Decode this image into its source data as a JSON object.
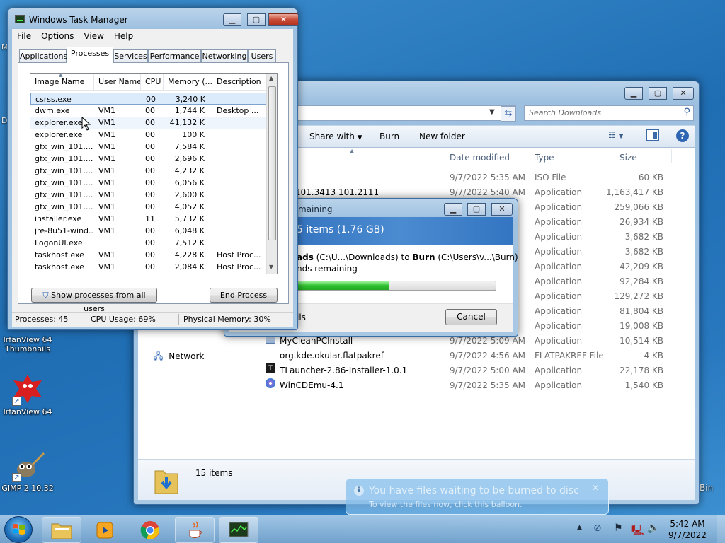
{
  "desktop": {
    "icons": [
      {
        "label": "IrfanView 64 Thumbnails"
      },
      {
        "label": "IrfanView 64"
      },
      {
        "label": "GIMP 2.10.32"
      }
    ],
    "edge_label_left": "M",
    "edge_label_left2": "D",
    "edge_label_right": "Bin"
  },
  "explorer": {
    "search_placeholder": "Search Downloads",
    "toolbar": {
      "share_with": "Share with",
      "burn": "Burn",
      "new_folder": "New folder"
    },
    "columns": {
      "date": "Date modified",
      "type": "Type",
      "size": "Size"
    },
    "nav": {
      "network": "Network"
    },
    "files": [
      {
        "name": "",
        "date": "9/7/2022 5:35 AM",
        "type": "ISO File",
        "size": "60 KB"
      },
      {
        "name": "vin 101.3413 101.2111",
        "date": "9/7/2022 5:40 AM",
        "type": "Application",
        "size": "1,163,417 KB"
      },
      {
        "name": "",
        "date": "",
        "type": "Application",
        "size": "259,066 KB"
      },
      {
        "name": "",
        "date": "",
        "type": "Application",
        "size": "26,934 KB"
      },
      {
        "name": "",
        "date": "",
        "type": "Application",
        "size": "3,682 KB"
      },
      {
        "name": "",
        "date": "",
        "type": "Application",
        "size": "3,682 KB"
      },
      {
        "name": "",
        "date": "",
        "type": "Application",
        "size": "42,209 KB"
      },
      {
        "name": "",
        "date": "",
        "type": "Application",
        "size": "92,284 KB"
      },
      {
        "name": "",
        "date": "",
        "type": "Application",
        "size": "129,272 KB"
      },
      {
        "name": "",
        "date": "",
        "type": "Application",
        "size": "81,804 KB"
      },
      {
        "name": "",
        "date": "",
        "type": "Application",
        "size": "19,008 KB"
      },
      {
        "name": "MyCleanPCInstall",
        "date": "9/7/2022 5:09 AM",
        "type": "Application",
        "size": "10,514 KB"
      },
      {
        "name": "org.kde.okular.flatpakref",
        "date": "9/7/2022 4:56 AM",
        "type": "FLATPAKREF File",
        "size": "4 KB"
      },
      {
        "name": "TLauncher-2.86-Installer-1.0.1",
        "date": "9/7/2022 5:00 AM",
        "type": "Application",
        "size": "22,178 KB"
      },
      {
        "name": "WinCDEmu-4.1",
        "date": "9/7/2022 5:35 AM",
        "type": "Application",
        "size": "1,540 KB"
      }
    ],
    "status_count": "15 items"
  },
  "copy_dialog": {
    "title": "maining",
    "heading": "5 items (1.76 GB)",
    "from_bold": "ads",
    "from_path": "(C:\\U...\\Downloads) to",
    "to_bold": "Burn",
    "to_path": "(C:\\Users\\v...\\Burn)",
    "remaining": "nds remaining",
    "progress": 0.46,
    "details": "ils",
    "cancel": "Cancel"
  },
  "task_manager": {
    "title": "Windows Task Manager",
    "menu": [
      "File",
      "Options",
      "View",
      "Help"
    ],
    "tabs": [
      "Applications",
      "Processes",
      "Services",
      "Performance",
      "Networking",
      "Users"
    ],
    "active_tab": 1,
    "columns": [
      "Image Name",
      "User Name",
      "CPU",
      "Memory (...",
      "Description"
    ],
    "processes": [
      {
        "image": "csrss.exe",
        "user": "",
        "cpu": "00",
        "mem": "3,240 K",
        "desc": ""
      },
      {
        "image": "dwm.exe",
        "user": "VM1",
        "cpu": "00",
        "mem": "1,744 K",
        "desc": "Desktop ..."
      },
      {
        "image": "explorer.exe",
        "user": "VM1",
        "cpu": "00",
        "mem": "41,132 K",
        "desc": ""
      },
      {
        "image": "explorer.exe",
        "user": "VM1",
        "cpu": "00",
        "mem": "100 K",
        "desc": ""
      },
      {
        "image": "gfx_win_101....",
        "user": "VM1",
        "cpu": "00",
        "mem": "7,584 K",
        "desc": ""
      },
      {
        "image": "gfx_win_101....",
        "user": "VM1",
        "cpu": "00",
        "mem": "2,696 K",
        "desc": ""
      },
      {
        "image": "gfx_win_101....",
        "user": "VM1",
        "cpu": "00",
        "mem": "4,232 K",
        "desc": ""
      },
      {
        "image": "gfx_win_101....",
        "user": "VM1",
        "cpu": "00",
        "mem": "6,056 K",
        "desc": ""
      },
      {
        "image": "gfx_win_101....",
        "user": "VM1",
        "cpu": "00",
        "mem": "2,600 K",
        "desc": ""
      },
      {
        "image": "gfx_win_101....",
        "user": "VM1",
        "cpu": "00",
        "mem": "4,052 K",
        "desc": ""
      },
      {
        "image": "installer.exe",
        "user": "VM1",
        "cpu": "11",
        "mem": "5,732 K",
        "desc": ""
      },
      {
        "image": "jre-8u51-wind...",
        "user": "VM1",
        "cpu": "00",
        "mem": "6,048 K",
        "desc": ""
      },
      {
        "image": "LogonUI.exe",
        "user": "",
        "cpu": "00",
        "mem": "7,512 K",
        "desc": ""
      },
      {
        "image": "taskhost.exe",
        "user": "VM1",
        "cpu": "00",
        "mem": "4,228 K",
        "desc": "Host Proc..."
      },
      {
        "image": "taskhost.exe",
        "user": "VM1",
        "cpu": "00",
        "mem": "2,084 K",
        "desc": "Host Proc..."
      }
    ],
    "show_all_button": "Show processes from all users",
    "end_process_button": "End Process",
    "status": {
      "processes": "Processes: 45",
      "cpu": "CPU Usage: 69%",
      "memory": "Physical Memory: 30%"
    }
  },
  "balloon": {
    "title": "You have files waiting to be burned to disc",
    "text": "To view the files now, click this balloon."
  },
  "taskbar": {
    "time": "5:42 AM",
    "date": "9/7/2022"
  },
  "icons": {
    "start": "windows-orb-icon",
    "explorer": "folder-icon",
    "media": "media-player-icon",
    "chrome": "chrome-icon",
    "java": "java-icon",
    "taskmgr": "task-manager-icon"
  }
}
